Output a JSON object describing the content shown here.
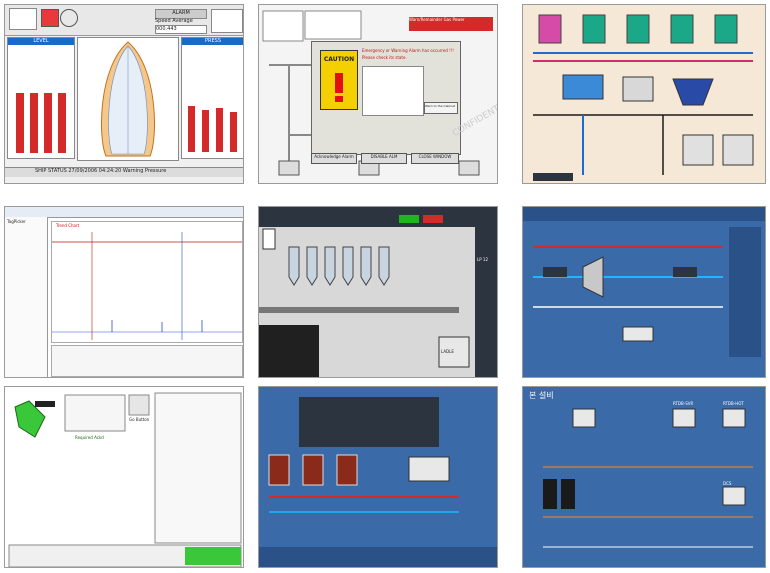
{
  "screens": [
    {
      "id": "ship-level",
      "level_title": "LEVEL",
      "press_title": "PRESS",
      "alarm_label": "ALARM",
      "speed_label": "Speed Average",
      "speed_value": "000.443",
      "status_bar": "SHIP STATUS 27/09/2006 04:24:20    Warning Pressure"
    },
    {
      "id": "caution-dialog",
      "caution_label": "CAUTION",
      "heading": "Emergency or Warning Alarm has occurred !!!",
      "subheading": "Please check its state.",
      "buttons": [
        "Acknowledge Alarm",
        "DISABLE ALM",
        "CLOSE WINDOW"
      ],
      "warn_button": "Warn to the Cabinet",
      "top_box": "Warn/Remainder Gas Power",
      "watermark": "CONFIDENTIAL"
    },
    {
      "id": "process-tanks",
      "title": ""
    },
    {
      "id": "trend",
      "tree_title": "TagPicker",
      "trend_title": "Trend Chart"
    },
    {
      "id": "silo",
      "lp_label": "LP 12",
      "ladle_label": "LADLE"
    },
    {
      "id": "plant-overview",
      "title": ""
    },
    {
      "id": "robot-status",
      "button": "Go Button",
      "col_title": "Required Ackd"
    },
    {
      "id": "boiler-tanks",
      "title": ""
    },
    {
      "id": "network",
      "title": "본 설비",
      "dcs_label": "DCS",
      "nodes": [
        "RTDB-SVR",
        "RTDB-HOT",
        "DCS"
      ]
    }
  ],
  "colors": {
    "level_bar": "#d42a2a",
    "press_bar": "#d42a2a",
    "bg_blue": "#3a6aa8",
    "caution_yellow": "#f4d000",
    "tank_green": "#1aa888",
    "tank_pink": "#d64aa8",
    "dark_panel": "#2c3440"
  }
}
